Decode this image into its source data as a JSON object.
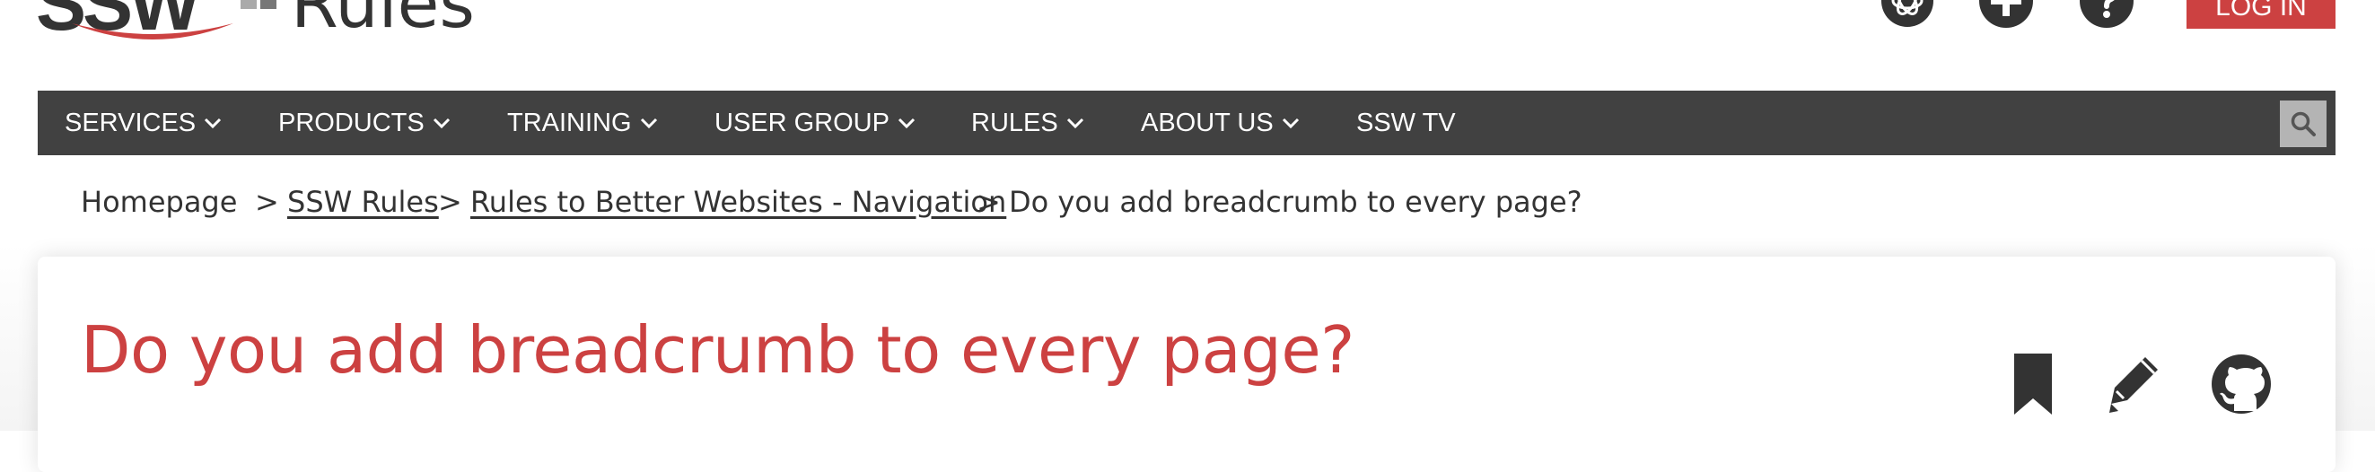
{
  "header": {
    "logo_text": "SSW",
    "site_title": "Rules",
    "icons": [
      "openai-icon",
      "plus-circle-icon",
      "help-circle-icon"
    ],
    "login_label": "LOG IN"
  },
  "nav": {
    "items": [
      {
        "label": "SERVICES",
        "dropdown": true
      },
      {
        "label": "PRODUCTS",
        "dropdown": true
      },
      {
        "label": "TRAINING",
        "dropdown": true
      },
      {
        "label": "USER GROUP",
        "dropdown": true
      },
      {
        "label": "RULES",
        "dropdown": true
      },
      {
        "label": "ABOUT US",
        "dropdown": true
      },
      {
        "label": "SSW TV",
        "dropdown": false
      }
    ],
    "search_icon": "search-icon"
  },
  "breadcrumb": {
    "items": [
      {
        "label": "Homepage",
        "link": false
      },
      {
        "label": "SSW Rules",
        "link": true
      },
      {
        "label": "Rules to Better Websites - Navigation",
        "link": true
      },
      {
        "label": "Do you add breadcrumb to every page?",
        "link": false
      }
    ],
    "separator": ">"
  },
  "rule": {
    "title": "Do you add breadcrumb to every page?",
    "actions": [
      "bookmark-icon",
      "edit-pencil-icon",
      "github-icon"
    ]
  },
  "colors": {
    "brand_red": "#cc4141",
    "nav_bg": "#414141",
    "text_dark": "#333333",
    "search_bg": "#b4b4b4"
  }
}
